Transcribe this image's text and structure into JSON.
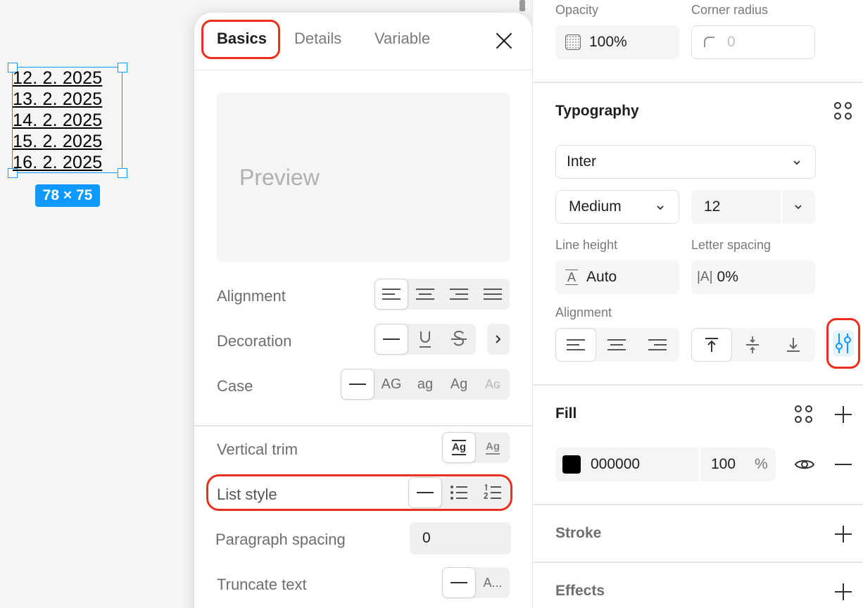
{
  "canvas": {
    "lines": [
      "12. 2. 2025",
      "13. 2. 2025",
      "14. 2. 2025",
      "15. 2. 2025",
      "16. 2. 2025"
    ],
    "size_badge": "78 × 75"
  },
  "popover": {
    "tabs": [
      {
        "label": "Basics",
        "active": true
      },
      {
        "label": "Details",
        "active": false
      },
      {
        "label": "Variable",
        "active": false
      }
    ],
    "preview_text": "Preview",
    "rows": {
      "alignment": "Alignment",
      "decoration": "Decoration",
      "case": "Case",
      "case_options": [
        "AG",
        "ag",
        "Ag",
        "Aɢ"
      ],
      "vertical_trim": "Vertical trim",
      "vertical_trim_glyph": "Ag",
      "list_style": "List style",
      "paragraph_spacing": "Paragraph spacing",
      "paragraph_spacing_value": "0",
      "truncate_text": "Truncate text",
      "truncate_option": "A..."
    }
  },
  "panel": {
    "opacity_label": "Opacity",
    "opacity_value": "100%",
    "corner_radius_label": "Corner radius",
    "corner_radius_value": "0",
    "typography_title": "Typography",
    "font_family": "Inter",
    "font_weight": "Medium",
    "font_size": "12",
    "line_height_label": "Line height",
    "line_height_value": "Auto",
    "line_height_glyph": "A",
    "letter_spacing_label": "Letter spacing",
    "letter_spacing_glyph": "|A|",
    "letter_spacing_value": "0%",
    "alignment_label": "Alignment",
    "fill_title": "Fill",
    "fill_hex": "000000",
    "fill_opacity": "100",
    "fill_percent": "%",
    "fill_color": "#000000",
    "stroke_title": "Stroke",
    "effects_title": "Effects"
  },
  "colors": {
    "accent": "#0d99ff",
    "highlight": "#e8301c"
  }
}
